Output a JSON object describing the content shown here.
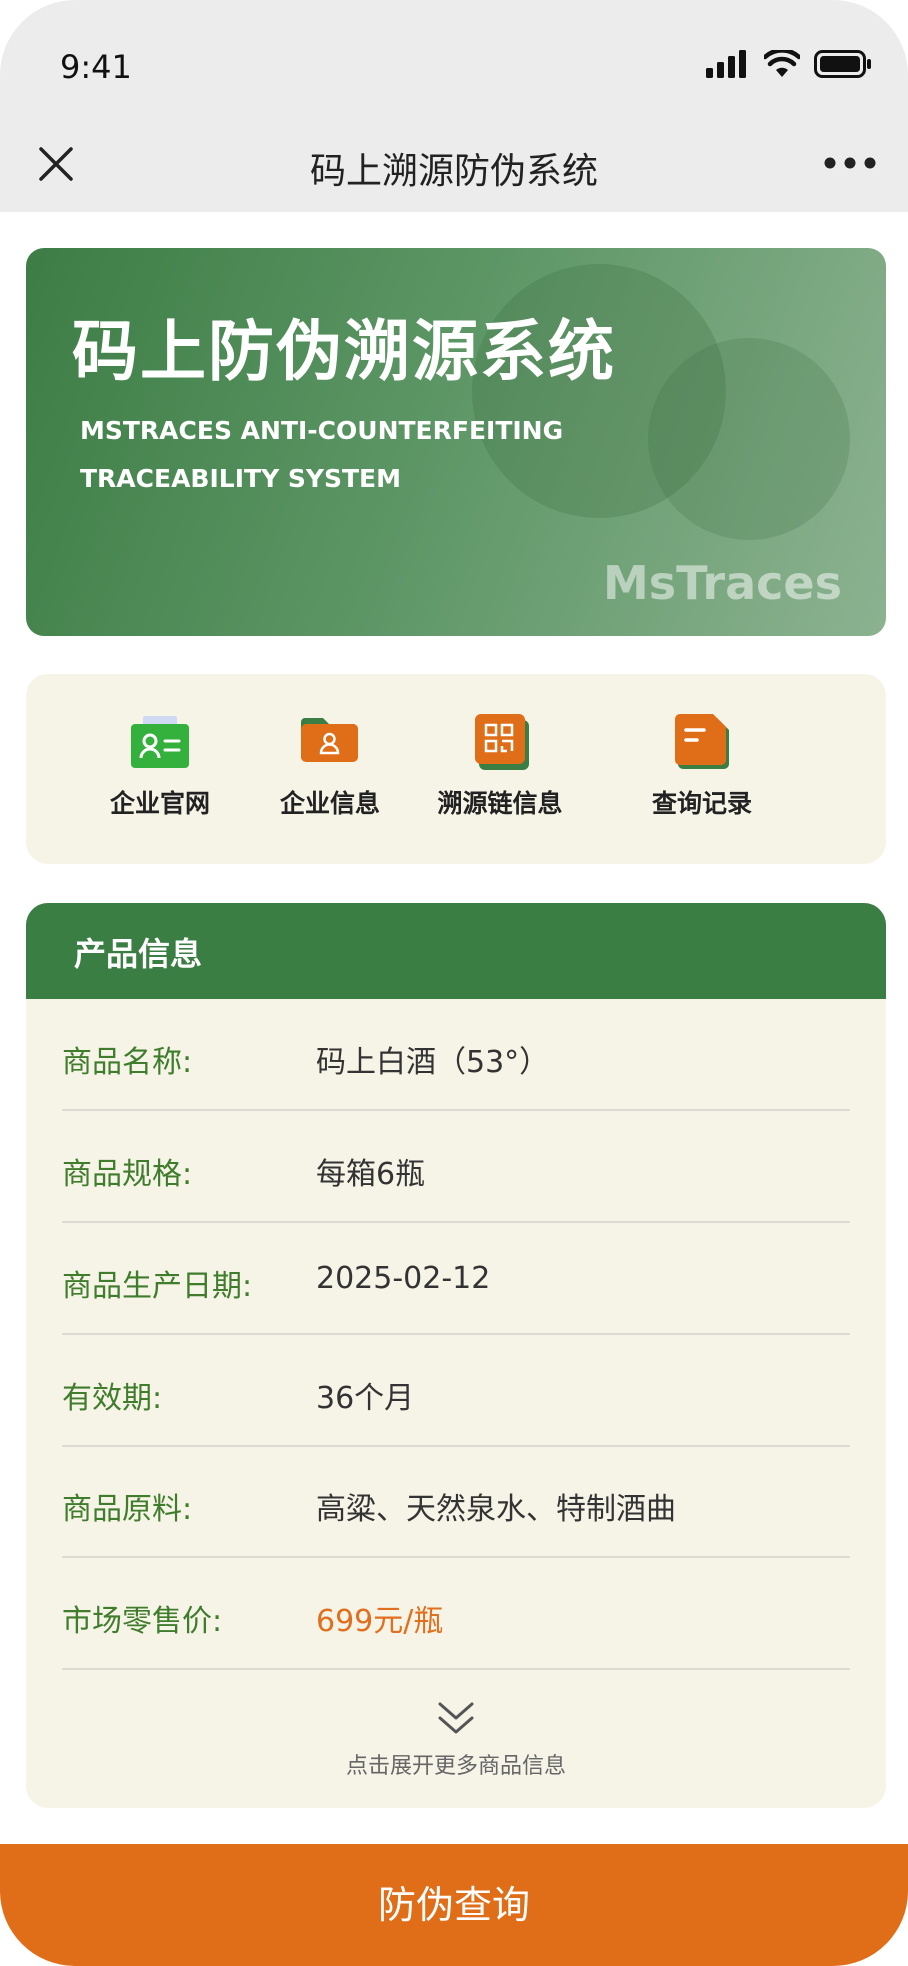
{
  "status": {
    "time": "9:41"
  },
  "nav": {
    "title": "码上溯源防伪系统"
  },
  "banner": {
    "title": "码上防伪溯源系统",
    "subtitle_line1": "MSTRACES ANTI-COUNTERFEITING",
    "subtitle_line2": "TRACEABILITY SYSTEM",
    "brand": "MsTraces"
  },
  "quick_links": [
    {
      "label": "企业官网",
      "icon": "id-card-icon"
    },
    {
      "label": "企业信息",
      "icon": "folder-user-icon"
    },
    {
      "label": "溯源链信息",
      "icon": "qr-code-icon"
    },
    {
      "label": "查询记录",
      "icon": "document-icon"
    }
  ],
  "product": {
    "header": "产品信息",
    "rows": [
      {
        "label": "商品名称:",
        "value": "码上白酒（53°）"
      },
      {
        "label": "商品规格:",
        "value": "每箱6瓶"
      },
      {
        "label": "商品生产日期:",
        "value": "2025-02-12"
      },
      {
        "label": "有效期:",
        "value": "36个月"
      },
      {
        "label": "商品原料:",
        "value": "高粱、天然泉水、特制酒曲"
      },
      {
        "label": "市场零售价:",
        "value": "699元/瓶"
      }
    ],
    "expand_text": "点击展开更多商品信息"
  },
  "bottom": {
    "button_label": "防伪查询"
  },
  "colors": {
    "primary_green": "#3b7e44",
    "accent_orange": "#e06d17",
    "card_bg": "#f6f3e7",
    "label_green": "#3f7d2c"
  }
}
